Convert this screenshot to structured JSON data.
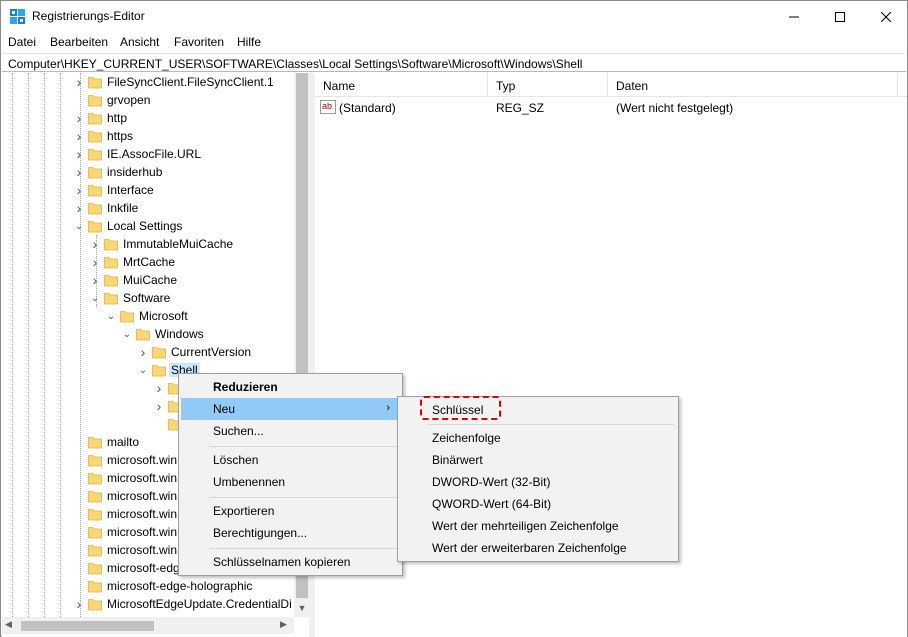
{
  "window": {
    "title": "Registrierungs-Editor"
  },
  "menu": [
    "Datei",
    "Bearbeiten",
    "Ansicht",
    "Favoriten",
    "Hilfe"
  ],
  "address": "Computer\\HKEY_CURRENT_USER\\SOFTWARE\\Classes\\Local Settings\\Software\\Microsoft\\Windows\\Shell",
  "tree": [
    {
      "label": "FileSyncClient.FileSyncClient.1",
      "level": 0,
      "expander": "collapsed"
    },
    {
      "label": "grvopen",
      "level": 0,
      "expander": "none"
    },
    {
      "label": "http",
      "level": 0,
      "expander": "collapsed"
    },
    {
      "label": "https",
      "level": 0,
      "expander": "collapsed"
    },
    {
      "label": "IE.AssocFile.URL",
      "level": 0,
      "expander": "collapsed"
    },
    {
      "label": "insiderhub",
      "level": 0,
      "expander": "collapsed"
    },
    {
      "label": "Interface",
      "level": 0,
      "expander": "collapsed"
    },
    {
      "label": "Inkfile",
      "level": 0,
      "expander": "collapsed"
    },
    {
      "label": "Local Settings",
      "level": 0,
      "expander": "expanded"
    },
    {
      "label": "ImmutableMuiCache",
      "level": 1,
      "expander": "collapsed"
    },
    {
      "label": "MrtCache",
      "level": 1,
      "expander": "collapsed"
    },
    {
      "label": "MuiCache",
      "level": 1,
      "expander": "collapsed"
    },
    {
      "label": "Software",
      "level": 1,
      "expander": "expanded"
    },
    {
      "label": "Microsoft",
      "level": 2,
      "expander": "expanded"
    },
    {
      "label": "Windows",
      "level": 3,
      "expander": "expanded"
    },
    {
      "label": "CurrentVersion",
      "level": 4,
      "expander": "collapsed"
    },
    {
      "label": "Shell",
      "level": 4,
      "expander": "expanded",
      "selected": true
    },
    {
      "label": "",
      "level": 5,
      "expander": "collapsed"
    },
    {
      "label": "",
      "level": 5,
      "expander": "collapsed"
    },
    {
      "label": "",
      "level": 5,
      "expander": "none"
    },
    {
      "label": "mailto",
      "level": 0,
      "expander": "none"
    },
    {
      "label": "microsoft.win",
      "level": 0,
      "expander": "none"
    },
    {
      "label": "microsoft.win",
      "level": 0,
      "expander": "none"
    },
    {
      "label": "microsoft.win",
      "level": 0,
      "expander": "none"
    },
    {
      "label": "microsoft.win",
      "level": 0,
      "expander": "none"
    },
    {
      "label": "microsoft.win",
      "level": 0,
      "expander": "none"
    },
    {
      "label": "microsoft.win",
      "level": 0,
      "expander": "none"
    },
    {
      "label": "microsoft-edg",
      "level": 0,
      "expander": "none"
    },
    {
      "label": "microsoft-edge-holographic",
      "level": 0,
      "expander": "none"
    },
    {
      "label": "MicrosoftEdgeUpdate.CredentialDi",
      "level": 0,
      "expander": "collapsed"
    }
  ],
  "list": {
    "columns": [
      "Name",
      "Typ",
      "Daten"
    ],
    "rows": [
      {
        "name": "(Standard)",
        "type": "REG_SZ",
        "data": "(Wert nicht festgelegt)",
        "icon": "ab-string-icon"
      }
    ]
  },
  "context_menu": {
    "items": [
      {
        "label": "Reduzieren",
        "bold": true
      },
      {
        "label": "Neu",
        "submenu": true,
        "highlighted": true
      },
      {
        "label": "Suchen..."
      },
      {
        "label": "Löschen"
      },
      {
        "label": "Umbenennen"
      },
      {
        "label": "Exportieren"
      },
      {
        "label": "Berechtigungen..."
      },
      {
        "label": "Schlüsselnamen kopieren"
      }
    ]
  },
  "submenu": {
    "items": [
      "Schlüssel",
      "Zeichenfolge",
      "Binärwert",
      "DWORD-Wert (32-Bit)",
      "QWORD-Wert (64-Bit)",
      "Wert der mehrteiligen Zeichenfolge",
      "Wert der erweiterbaren Zeichenfolge"
    ]
  },
  "colors": {
    "selection": "#cce8ff",
    "menu_highlight": "#91c9f7",
    "folder": "#f8d775",
    "annotation": "#e00000"
  }
}
